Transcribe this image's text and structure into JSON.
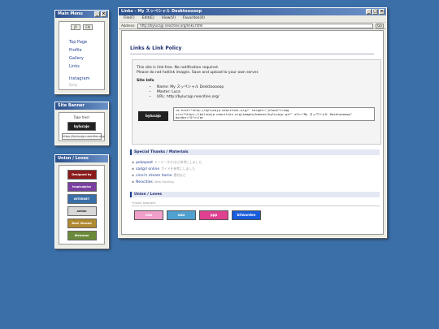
{
  "menu_window": {
    "title": "Main Menu",
    "lang": [
      "JP",
      "EN"
    ],
    "items": [
      "Top Page",
      "Profile",
      "Gallery",
      "Links"
    ],
    "items_extra": [
      "Instagram"
    ],
    "dim_item": "Daily"
  },
  "banner_window": {
    "title": "Site Banner",
    "take_free": "Take free!",
    "banner_text": "bylucajo",
    "url": "https://bylucajp.neocities.org/"
  },
  "union_window": {
    "title": "Union / Loves",
    "badges": [
      {
        "text": "Designed by Neocities",
        "color": "#8b1a1a"
      },
      {
        "text": "tropicalpics",
        "color": "#7a3fa0"
      },
      {
        "text": "INTERNET EXPLORER",
        "color": "#3a6ea8"
      },
      {
        "text": "anime",
        "color": "#d8d8d8"
      },
      {
        "text": "Best Viewed With Eyes",
        "color": "#b08a30"
      },
      {
        "text": "Welcome",
        "color": "#6a8a3a"
      }
    ]
  },
  "main_window": {
    "title": "Links - My スッペシャル Desktooooop",
    "menubar": [
      "File(F)",
      "Edit(E)",
      "View(V)",
      "Favorites(A)"
    ],
    "address_label": "Address:",
    "address_value": "http://bylucajp.neocities.org/links.html",
    "go_label": "Go",
    "page_title": "Links & Link Policy",
    "policy_lines": [
      "This site is link-free. No notification required.",
      "Please do not hotlink images. Save and upload to your own server."
    ],
    "site_info_heading": "Site Info",
    "site_info": [
      "Name: My スッペシャル Desktooooop",
      "Master: Luca",
      "URL: http://bylucajp.neocities.org/"
    ],
    "banner_label": "bylucajo",
    "code_snippet": "<a href=\"http://bylucajp.neocities.org/\" target=\"_blank\"><img src=\"https://bylucajp.neocities.org/images/banner/bylucajp.gif\" alt=\"My スッペシャル Desktooooop\" border=\"0\"></a>",
    "thanks_heading": "Special Thanks / Materials",
    "thanks": [
      {
        "name": "pekopoet",
        "note": "テーマ・タグ/など参考にしました"
      },
      {
        "name": "sadgrl online",
        "note": "ガイドを参考にしました"
      },
      {
        "name": "cinni's dream home",
        "note": "素材など"
      },
      {
        "name": "Neocities",
        "note": "Web Hosting"
      }
    ],
    "union_heading": "Union / Loves",
    "union_note": "*Union banners",
    "union_banners": [
      {
        "text": "ooo",
        "color": "#f0a0c8"
      },
      {
        "text": "uuu",
        "color": "#50a0d0"
      },
      {
        "text": "ppp",
        "color": "#e04090"
      },
      {
        "text": "bitwarden",
        "color": "#175ddc"
      }
    ]
  }
}
